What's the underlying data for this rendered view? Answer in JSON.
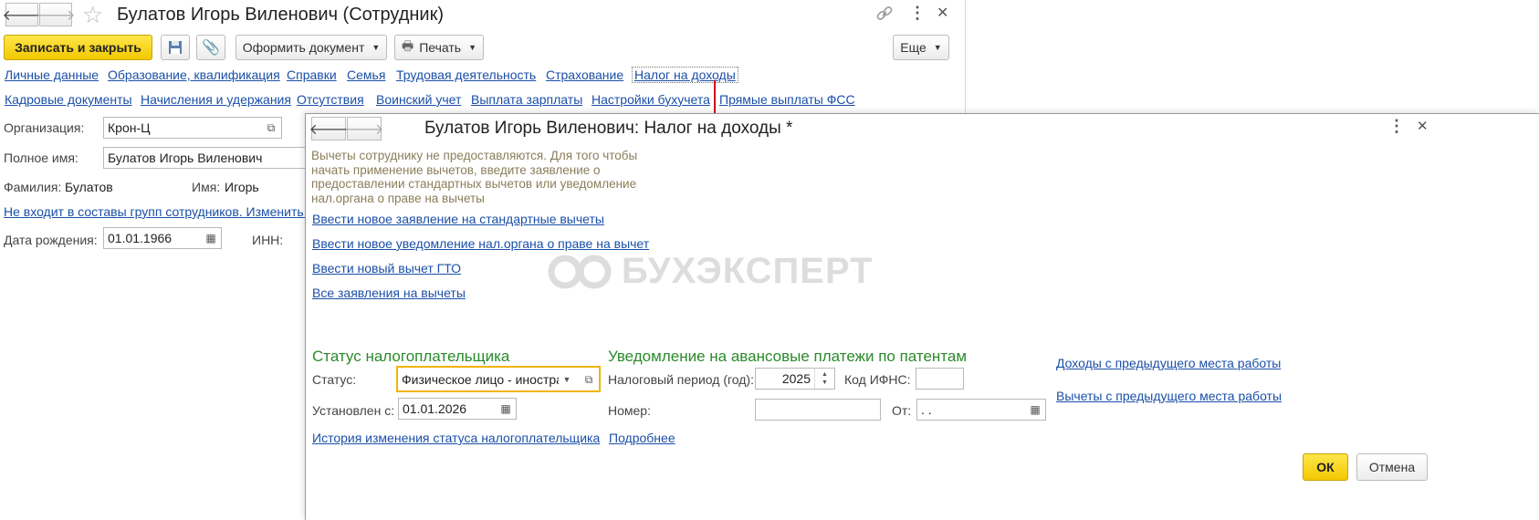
{
  "main_window": {
    "title": "Булатов Игорь Виленович (Сотрудник)",
    "toolbar": {
      "save_close": "Записать и закрыть",
      "make_document": "Оформить документ",
      "print": "Печать",
      "more": "Еще"
    },
    "nav_row1": [
      "Личные данные",
      "Образование, квалификация",
      "Справки",
      "Семья",
      "Трудовая деятельность",
      "Страхование",
      "Налог на доходы"
    ],
    "nav_row2": [
      "Кадровые документы",
      "Начисления и удержания",
      "Отсутствия",
      "Воинский учет",
      "Выплата зарплаты",
      "Настройки бухучета",
      "Прямые выплаты ФСС"
    ],
    "form": {
      "org_label": "Организация:",
      "org_value": "Крон-Ц",
      "fullname_label": "Полное имя:",
      "fullname_value": "Булатов Игорь Виленович",
      "lastname_label": "Фамилия:",
      "lastname_value": "Булатов",
      "firstname_label": "Имя:",
      "firstname_value": "Игорь",
      "groups_link": "Не входит в составы групп сотрудников. Изменить...",
      "birthdate_label": "Дата рождения:",
      "birthdate_value": "01.01.1966",
      "inn_label": "ИНН:"
    }
  },
  "dialog": {
    "title": "Булатов Игорь Виленович: Налог на доходы *",
    "info_text": [
      "Вычеты сотруднику не предоставляются. Для того чтобы",
      "начать применение вычетов, введите заявление о",
      "предоставлении стандартных вычетов или уведомление",
      "нал.органа о праве на вычеты"
    ],
    "links": [
      "Ввести новое заявление на стандартные вычеты",
      "Ввести новое уведомление нал.органа о праве на вычет",
      "Ввести новый вычет ГТО",
      "Все заявления на вычеты"
    ],
    "watermark": "БУХЭКСПЕРТ",
    "taxpayer": {
      "title": "Статус налогоплательщика",
      "status_label": "Статус:",
      "status_value": "Физическое лицо - иностра",
      "since_label": "Установлен с:",
      "since_value": "01.01.2026",
      "history_link": "История изменения статуса налогоплательщика"
    },
    "patent": {
      "title": "Уведомление на авансовые платежи по патентам",
      "period_label": "Налоговый период (год):",
      "period_value": "2025",
      "ifns_label": "Код ИФНС:",
      "ifns_value": "",
      "number_label": "Номер:",
      "number_value": "",
      "from_label": "От:",
      "from_value": " .  .",
      "details_link": "Подробнее"
    },
    "right_links": [
      "Доходы с предыдущего места работы",
      "Вычеты с предыдущего места работы"
    ],
    "ok": "ОК",
    "cancel": "Отмена"
  },
  "colors": {
    "accent_yellow": "#f2c800",
    "link_blue": "#1b4fa8",
    "section_green": "#2a8a2a",
    "arrow_red": "#d0021b",
    "focus_orange": "#f0b400"
  }
}
